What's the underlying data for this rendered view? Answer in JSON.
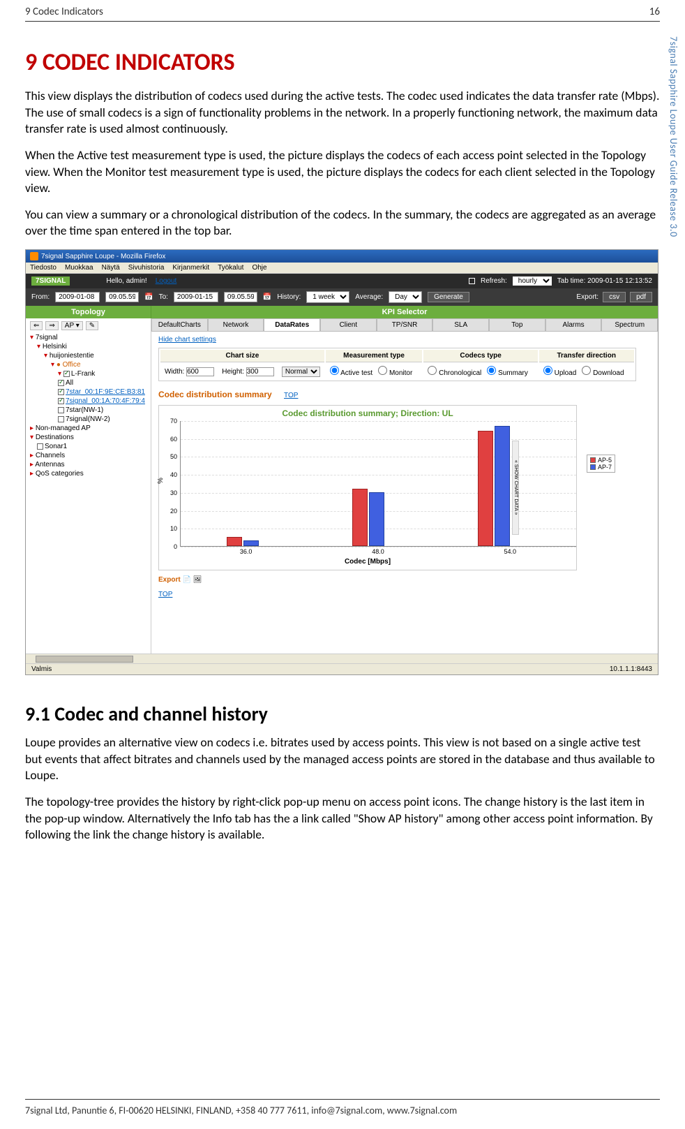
{
  "header": {
    "left": "9 Codec Indicators",
    "right": "16"
  },
  "side_label": "7signal Sapphire Loupe User Guide Release 3.0",
  "h1": "9 CODEC INDICATORS",
  "para1": "This view displays the distribution of codecs used during the active tests. The codec used indicates the data transfer rate (Mbps). The use of small codecs is a sign of functionality problems in the network. In a properly functioning network, the maximum data transfer rate is used almost continuously.",
  "para2": "When the Active test measurement type is used, the picture displays the codecs of each access point selected in the Topology view. When the Monitor test measurement type is used, the picture displays the codecs for each client selected in the Topology view.",
  "para3": "You can view a summary or a chronological distribution of the codecs. In the summary, the codecs are aggregated as an average over the time span entered in the top bar.",
  "h2": "9.1 Codec and channel history",
  "para4": "Loupe provides an alternative view on codecs i.e. bitrates used by access points. This view is not based on a single active test but events that affect bitrates and channels used by the managed access points are stored in the database and thus available to Loupe.",
  "para5": "The topology-tree provides the history by right-click pop-up menu on access point icons. The change history is the last item in the pop-up window. Alternatively the Info tab has the a link called \"Show AP history\" among other access point information. By following the link the change history is available.",
  "footer": "7signal Ltd, Panuntie 6, FI-00620 HELSINKI, FINLAND, +358 40 777 7611, info@7signal.com, www.7signal.com",
  "screenshot": {
    "window_title": "7signal Sapphire Loupe - Mozilla Firefox",
    "ff_menu": [
      "Tiedosto",
      "Muokkaa",
      "Näytä",
      "Sivuhistoria",
      "Kirjanmerkit",
      "Työkalut",
      "Ohje"
    ],
    "topbar": {
      "hello": "Hello, admin!",
      "logout": "Logout",
      "refresh_label": "Refresh:",
      "refresh_value": "hourly",
      "tab_time": "Tab time: 2009-01-15 12:13:52"
    },
    "filterbar": {
      "from_label": "From:",
      "from_date": "2009-01-08",
      "from_time": "09.05.59",
      "to_label": "To:",
      "to_date": "2009-01-15",
      "to_time": "09.05.59",
      "history_label": "History:",
      "history_value": "1 week",
      "average_label": "Average:",
      "average_value": "Day",
      "generate": "Generate",
      "export_label": "Export:",
      "export_csv": "csv",
      "export_pdf": "pdf"
    },
    "greenbar": {
      "left": "Topology",
      "right": "KPI Selector"
    },
    "sidebar": {
      "nav": [
        "⇐",
        "⇒",
        "AP ▾",
        "✎"
      ],
      "tree": [
        {
          "level": 0,
          "marker": "▾",
          "label": "7signal"
        },
        {
          "level": 1,
          "marker": "▾",
          "label": "Helsinki"
        },
        {
          "level": 2,
          "marker": "▾",
          "label": "huijoniestentie"
        },
        {
          "level": 3,
          "marker": "▾",
          "label": "Office",
          "orange": true
        },
        {
          "level": 4,
          "marker": "▾",
          "label": "L-Frank",
          "cb": true,
          "checked": true
        },
        {
          "level": 4,
          "label": "All",
          "cb": true,
          "checked": true,
          "nomark": true
        },
        {
          "level": 4,
          "label": "7star_00:1F:9E:CE:B3:81",
          "cb": true,
          "checked": true,
          "link": true,
          "nomark": true
        },
        {
          "level": 4,
          "label": "7signal_00:1A:70:4F:79:4",
          "cb": true,
          "checked": true,
          "link": true,
          "nomark": true
        },
        {
          "level": 4,
          "label": "7star(NW-1)",
          "cb": true,
          "nomark": true
        },
        {
          "level": 4,
          "label": "7signal(NW-2)",
          "cb": true,
          "nomark": true
        },
        {
          "level": 0,
          "marker": "▸",
          "label": "Non-managed AP"
        },
        {
          "level": 0,
          "marker": "▾",
          "label": "Destinations"
        },
        {
          "level": 1,
          "label": "Sonar1",
          "cb": true,
          "nomark": true
        },
        {
          "level": 0,
          "marker": "▸",
          "label": "Channels"
        },
        {
          "level": 0,
          "marker": "▸",
          "label": "Antennas"
        },
        {
          "level": 0,
          "marker": "▸",
          "label": "QoS categories"
        }
      ]
    },
    "tabs": [
      "DefaultCharts",
      "Network",
      "DataRates",
      "Client",
      "TP/SNR",
      "SLA",
      "Top",
      "Alarms",
      "Spectrum"
    ],
    "active_tab": 2,
    "hide_settings": "Hide chart settings",
    "settings": {
      "headers": [
        "Chart size",
        "Measurement type",
        "Codecs type",
        "Transfer direction"
      ],
      "width_label": "Width:",
      "width_value": "600",
      "height_label": "Height:",
      "height_value": "300",
      "size_mode": "Normal",
      "measurement": [
        {
          "label": "Active test",
          "checked": true
        },
        {
          "label": "Monitor",
          "checked": false
        }
      ],
      "codecs": [
        {
          "label": "Chronological",
          "checked": false
        },
        {
          "label": "Summary",
          "checked": true
        }
      ],
      "transfer": [
        {
          "label": "Upload",
          "checked": true
        },
        {
          "label": "Download",
          "checked": false
        }
      ]
    },
    "section_title": "Codec distribution summary",
    "top_link": "TOP",
    "chart": {
      "title": "Codec distribution summary; Direction: UL",
      "ylabel": "%",
      "xlabel": "Codec [Mbps]"
    },
    "export_text": "Export",
    "legend": [
      "AP-5",
      "AP-7"
    ],
    "status_left": "Valmis",
    "status_right": "10.1.1.1:8443"
  },
  "chart_data": {
    "type": "bar",
    "categories": [
      "36.0",
      "48.0",
      "54.0"
    ],
    "series": [
      {
        "name": "AP-5",
        "values": [
          5,
          32,
          64
        ],
        "color": "#e04040"
      },
      {
        "name": "AP-7",
        "values": [
          3,
          30,
          67
        ],
        "color": "#4060e0"
      }
    ],
    "title": "Codec distribution summary; Direction: UL",
    "xlabel": "Codec [Mbps]",
    "ylabel": "%",
    "ylim": [
      0,
      70
    ],
    "yticks": [
      0,
      10,
      20,
      30,
      40,
      50,
      60,
      70
    ]
  }
}
